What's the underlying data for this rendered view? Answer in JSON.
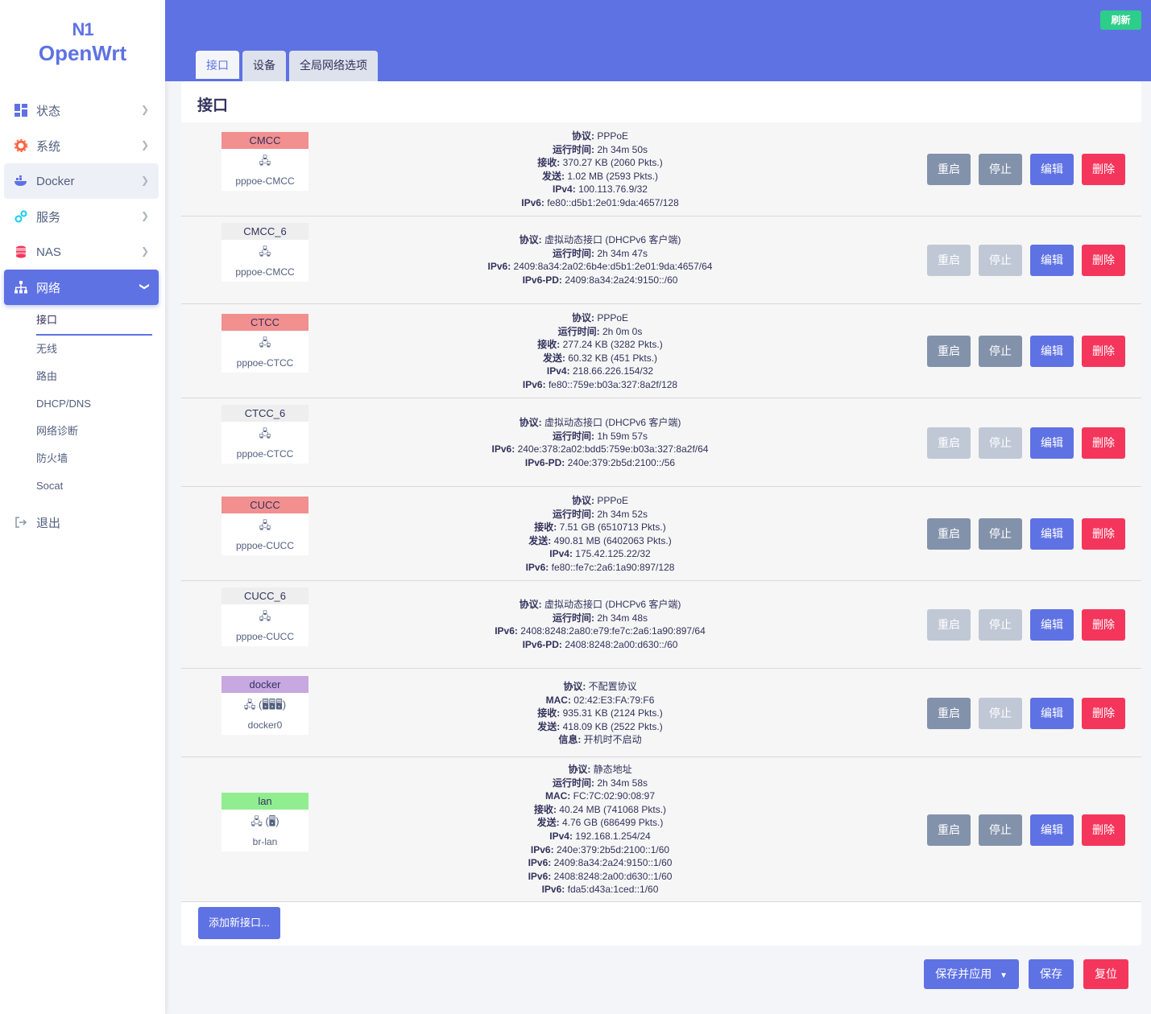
{
  "logo": {
    "line1": "N1",
    "line2": "OpenWrt"
  },
  "sidebar": {
    "items": [
      {
        "label": "状态",
        "icon": "dashboard-icon"
      },
      {
        "label": "系统",
        "icon": "gear-icon"
      },
      {
        "label": "Docker",
        "icon": "docker-icon"
      },
      {
        "label": "服务",
        "icon": "services-icon"
      },
      {
        "label": "NAS",
        "icon": "database-icon"
      },
      {
        "label": "网络",
        "icon": "network-icon"
      }
    ],
    "submenu": [
      "接口",
      "无线",
      "路由",
      "DHCP/DNS",
      "网络诊断",
      "防火墙",
      "Socat"
    ],
    "logout": "退出"
  },
  "header": {
    "refresh": "刷新",
    "tabs": [
      "接口",
      "设备",
      "全局网络选项"
    ]
  },
  "card": {
    "title": "接口",
    "add_button": "添加新接口..."
  },
  "actions": {
    "restart": "重启",
    "stop": "停止",
    "edit": "编辑",
    "delete": "删除"
  },
  "interfaces": [
    {
      "name": "CMCC",
      "color": "#f28f8f",
      "device": "pppoe-CMCC",
      "info": [
        [
          "协议:",
          "PPPoE"
        ],
        [
          "运行时间:",
          "2h 34m 50s"
        ],
        [
          "接收:",
          "370.27 KB (2060 Pkts.)"
        ],
        [
          "发送:",
          "1.02 MB (2593 Pkts.)"
        ],
        [
          "IPv4:",
          "100.113.76.9/32"
        ],
        [
          "IPv6:",
          "fe80::d5b1:2e01:9da:4657/128"
        ]
      ]
    },
    {
      "name": "CMCC_6",
      "color": "#eeeeee",
      "device": "pppoe-CMCC",
      "info": [
        [
          "协议:",
          "虚拟动态接口 (DHCPv6 客户端)"
        ],
        [
          "运行时间:",
          "2h 34m 47s"
        ],
        [
          "IPv6:",
          "2409:8a34:2a02:6b4e:d5b1:2e01:9da:4657/64"
        ],
        [
          "IPv6-PD:",
          "2409:8a34:2a24:9150::/60"
        ]
      ]
    },
    {
      "name": "CTCC",
      "color": "#f28f8f",
      "device": "pppoe-CTCC",
      "info": [
        [
          "协议:",
          "PPPoE"
        ],
        [
          "运行时间:",
          "2h 0m 0s"
        ],
        [
          "接收:",
          "277.24 KB (3282 Pkts.)"
        ],
        [
          "发送:",
          "60.32 KB (451 Pkts.)"
        ],
        [
          "IPv4:",
          "218.66.226.154/32"
        ],
        [
          "IPv6:",
          "fe80::759e:b03a:327:8a2f/128"
        ]
      ]
    },
    {
      "name": "CTCC_6",
      "color": "#eeeeee",
      "device": "pppoe-CTCC",
      "info": [
        [
          "协议:",
          "虚拟动态接口 (DHCPv6 客户端)"
        ],
        [
          "运行时间:",
          "1h 59m 57s"
        ],
        [
          "IPv6:",
          "240e:378:2a02:bdd5:759e:b03a:327:8a2f/64"
        ],
        [
          "IPv6-PD:",
          "240e:379:2b5d:2100::/56"
        ]
      ]
    },
    {
      "name": "CUCC",
      "color": "#f28f8f",
      "device": "pppoe-CUCC",
      "info": [
        [
          "协议:",
          "PPPoE"
        ],
        [
          "运行时间:",
          "2h 34m 52s"
        ],
        [
          "接收:",
          "7.51 GB (6510713 Pkts.)"
        ],
        [
          "发送:",
          "490.81 MB (6402063 Pkts.)"
        ],
        [
          "IPv4:",
          "175.42.125.22/32"
        ],
        [
          "IPv6:",
          "fe80::fe7c:2a6:1a90:897/128"
        ]
      ]
    },
    {
      "name": "CUCC_6",
      "color": "#eeeeee",
      "device": "pppoe-CUCC",
      "info": [
        [
          "协议:",
          "虚拟动态接口 (DHCPv6 客户端)"
        ],
        [
          "运行时间:",
          "2h 34m 48s"
        ],
        [
          "IPv6:",
          "2408:8248:2a80:e79:fe7c:2a6:1a90:897/64"
        ],
        [
          "IPv6-PD:",
          "2408:8248:2a00:d630::/60"
        ]
      ]
    },
    {
      "name": "docker",
      "color": "#c8a8e0",
      "device": "docker0",
      "info": [
        [
          "协议:",
          "不配置协议"
        ],
        [
          "MAC:",
          "02:42:E3:FA:79:F6"
        ],
        [
          "接收:",
          "935.31 KB (2124 Pkts.)"
        ],
        [
          "发送:",
          "418.09 KB (2522 Pkts.)"
        ],
        [
          "信息:",
          "开机时不启动"
        ]
      ]
    },
    {
      "name": "lan",
      "color": "#90ee90",
      "device": "br-lan",
      "info": [
        [
          "协议:",
          "静态地址"
        ],
        [
          "运行时间:",
          "2h 34m 58s"
        ],
        [
          "MAC:",
          "FC:7C:02:90:08:97"
        ],
        [
          "接收:",
          "40.24 MB (741068 Pkts.)"
        ],
        [
          "发送:",
          "4.76 GB (686499 Pkts.)"
        ],
        [
          "IPv4:",
          "192.168.1.254/24"
        ],
        [
          "IPv6:",
          "240e:379:2b5d:2100::1/60"
        ],
        [
          "IPv6:",
          "2409:8a34:2a24:9150::1/60"
        ],
        [
          "IPv6:",
          "2408:8248:2a00:d630::1/60"
        ],
        [
          "IPv6:",
          "fda5:d43a:1ced::1/60"
        ]
      ]
    }
  ],
  "footer": {
    "save_apply": "保存并应用",
    "save": "保存",
    "reset": "复位"
  }
}
